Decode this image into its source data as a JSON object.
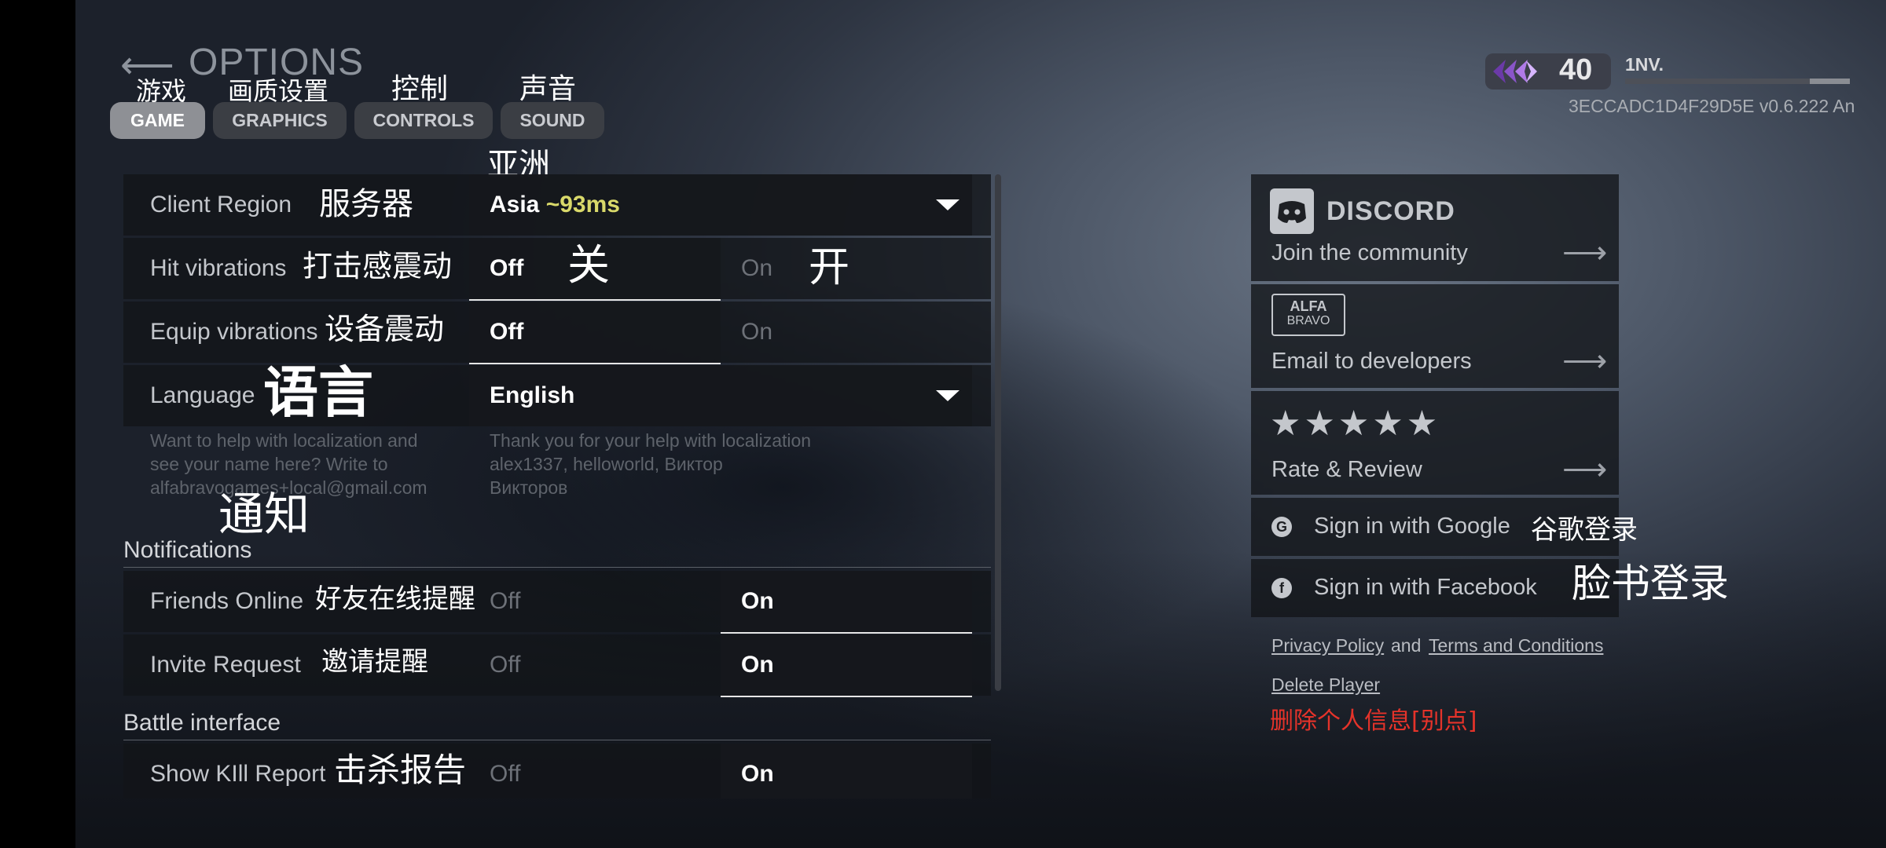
{
  "header": {
    "back_arrow": "⟵",
    "title": "OPTIONS",
    "tabs": [
      {
        "label": "GAME",
        "annotation": "游戏",
        "active": true
      },
      {
        "label": "GRAPHICS",
        "annotation": "画质设置",
        "active": false
      },
      {
        "label": "CONTROLS",
        "annotation": "控制",
        "active": false
      },
      {
        "label": "SOUND",
        "annotation": "声音",
        "active": false
      }
    ]
  },
  "player": {
    "level": "40",
    "name": "1NV.",
    "xp_progress": 0.82,
    "build": "3ECCADC1D4F29D5E v0.6.222 An"
  },
  "settings": {
    "client_region": {
      "label": "Client Region",
      "annotation": "服务器",
      "value": "Asia",
      "ping": "~93ms",
      "value_annotation": "亚洲"
    },
    "hit_vibrations": {
      "label": "Hit vibrations",
      "annotation": "打击感震动",
      "off": "Off",
      "on": "On",
      "off_annotation": "关",
      "on_annotation": "开",
      "selected": "off"
    },
    "equip_vibrations": {
      "label": "Equip vibrations",
      "annotation": "设备震动",
      "off": "Off",
      "on": "On",
      "selected": "off"
    },
    "language": {
      "label": "Language",
      "annotation": "语言",
      "value": "English"
    },
    "localization_help": {
      "left_lines": [
        "Want to help with localization and",
        "see your name here? Write to",
        "alfabravogames+local@gmail.com"
      ],
      "right_lines": [
        "Thank you for your help with localization",
        "alex1337, helloworld, Виктор",
        "Викторов"
      ]
    },
    "notifications_section": {
      "label": "Notifications",
      "annotation": "通知"
    },
    "friends_online": {
      "label": "Friends Online",
      "annotation": "好友在线提醒",
      "off": "Off",
      "on": "On",
      "selected": "on"
    },
    "invite_request": {
      "label": "Invite Request",
      "annotation": "邀请提醒",
      "off": "Off",
      "on": "On",
      "selected": "on"
    },
    "battle_section": {
      "label": "Battle interface"
    },
    "show_kill_report": {
      "label": "Show KIll Report",
      "annotation": "击杀报告",
      "off": "Off",
      "on": "On",
      "selected": "on"
    }
  },
  "right_panel": {
    "discord": {
      "brand": "DISCORD",
      "text": "Join the community",
      "arrow": "⟶"
    },
    "email": {
      "brand_top": "ALFA",
      "brand_bottom": "BRAVO",
      "text": "Email to developers",
      "arrow": "⟶"
    },
    "rate": {
      "stars": "★★★★★",
      "text": "Rate & Review",
      "arrow": "⟶"
    },
    "google": {
      "icon": "G",
      "text": "Sign in with Google",
      "annotation": "谷歌登录"
    },
    "facebook": {
      "icon": "f",
      "text": "Sign in with Facebook",
      "annotation": "脸书登录"
    },
    "privacy_policy": "Privacy Policy",
    "and": "and",
    "terms": "Terms and Conditions",
    "delete_player": "Delete Player",
    "delete_annotation": "删除个人信息[别点]"
  },
  "colors": {
    "ping": "#d9d96a",
    "warning": "#e5332a",
    "active_tab": "#8e9095"
  }
}
